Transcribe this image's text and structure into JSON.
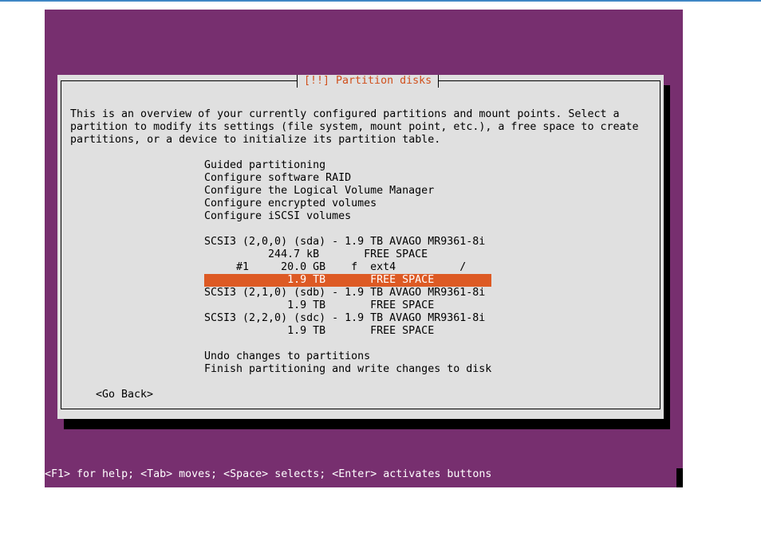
{
  "dialog": {
    "title": "[!!] Partition disks",
    "intro": [
      "This is an overview of your currently configured partitions and mount points. Select a",
      "partition to modify its settings (file system, mount point, etc.), a free space to create",
      "partitions, or a device to initialize its partition table."
    ],
    "menu": [
      "Guided partitioning",
      "Configure software RAID",
      "Configure the Logical Volume Manager",
      "Configure encrypted volumes",
      "Configure iSCSI volumes"
    ],
    "disks": [
      "SCSI3 (2,0,0) (sda) - 1.9 TB AVAGO MR9361-8i",
      "          244.7 kB       FREE SPACE",
      "     #1     20.0 GB    f  ext4          /",
      "             1.9 TB       FREE SPACE       ",
      "SCSI3 (2,1,0) (sdb) - 1.9 TB AVAGO MR9361-8i",
      "             1.9 TB       FREE SPACE",
      "SCSI3 (2,2,0) (sdc) - 1.9 TB AVAGO MR9361-8i",
      "             1.9 TB       FREE SPACE"
    ],
    "actions": [
      "Undo changes to partitions",
      "Finish partitioning and write changes to disk"
    ],
    "go_back": "<Go Back>"
  },
  "status_bar": "<F1> for help; <Tab> moves; <Space> selects; <Enter> activates buttons",
  "colors": {
    "background": "#772f6f",
    "dialog": "#e0e0e0",
    "title": "#d0501c",
    "selection": "#dd5a24"
  }
}
